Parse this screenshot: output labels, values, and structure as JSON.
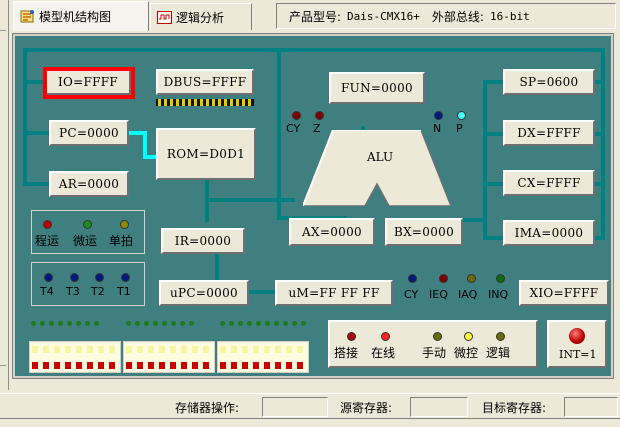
{
  "tabs": [
    {
      "label": "模型机结构图",
      "active": true,
      "icon": "structure-icon"
    },
    {
      "label": "逻辑分析",
      "active": false,
      "icon": "waveform-icon"
    }
  ],
  "product": {
    "model_label": "产品型号:",
    "model_value": "Dais-CMX16+",
    "bus_label": "外部总线:",
    "bus_value": "16-bit"
  },
  "registers": {
    "io": "IO=FFFF",
    "dbus": "DBUS=FFFF",
    "pc": "PC=0000",
    "ar": "AR=0000",
    "rom": "ROM=D0D1",
    "ir": "IR=0000",
    "upc": "uPC=0000",
    "um": "uM=FF FF FF",
    "fun": "FUN=0000",
    "ax": "AX=0000",
    "bx": "BX=0000",
    "sp": "SP=0600",
    "dx": "DX=FFFF",
    "cx": "CX=FFFF",
    "ima": "IMA=0000",
    "xio": "XIO=FFFF",
    "int": "INT=1"
  },
  "alu": {
    "label": "ALU",
    "flags_left": [
      "CY",
      "Z"
    ],
    "flags_right": [
      "N",
      "P"
    ]
  },
  "run_modes": [
    "程运",
    "微运",
    "单拍"
  ],
  "timing": [
    "T4",
    "T3",
    "T2",
    "T1"
  ],
  "um_flags": [
    "CY",
    "IEQ",
    "IAQ",
    "INQ"
  ],
  "switches": [
    "搭接",
    "在线",
    "手动",
    "微控",
    "逻辑"
  ],
  "colors": {
    "panel": "#3f7f80",
    "bus_line": "#008080",
    "highlight": "#ff0000",
    "active_wire": "#00ffff"
  },
  "status_bar": {
    "memory_op": "存储器操作:",
    "source_reg": "源寄存器:",
    "target_reg": "目标寄存器:"
  }
}
